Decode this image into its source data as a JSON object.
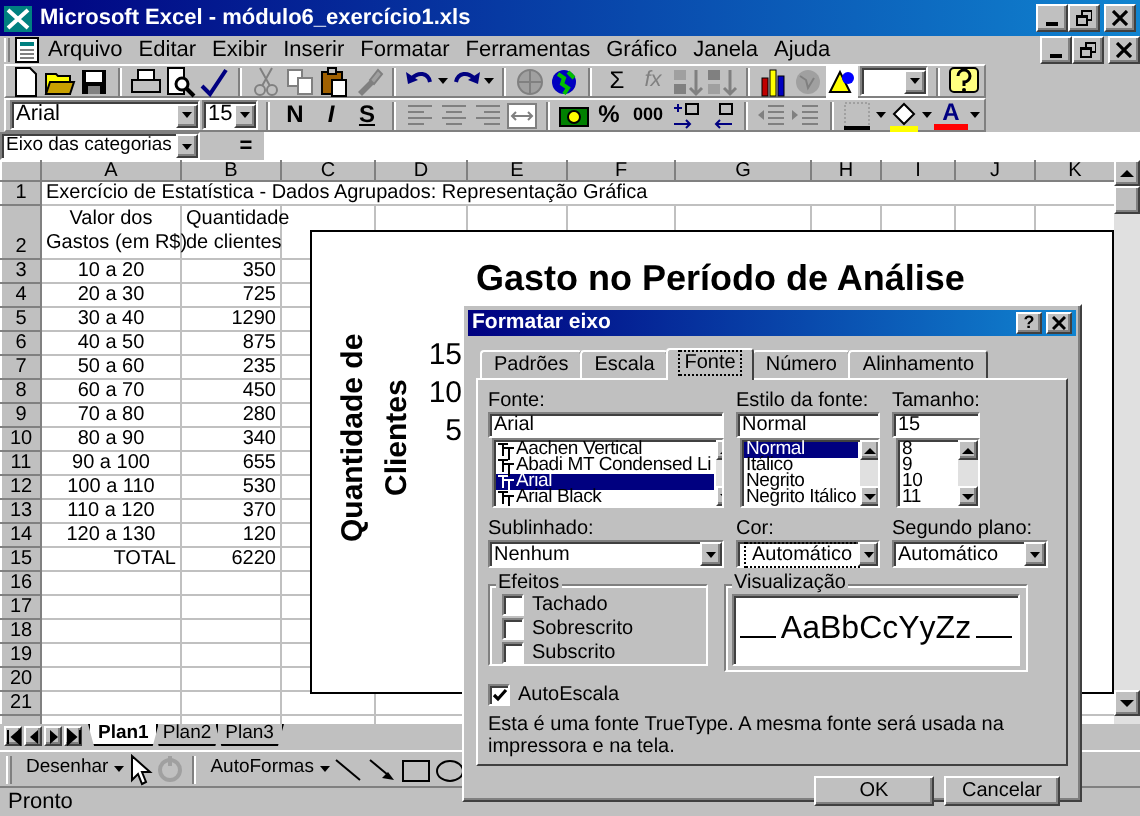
{
  "window": {
    "title": "Microsoft Excel - módulo6_exercício1.xls"
  },
  "menu": [
    "Arquivo",
    "Editar",
    "Exibir",
    "Inserir",
    "Formatar",
    "Ferramentas",
    "Gráfico",
    "Janela",
    "Ajuda"
  ],
  "standard_toolbar": {
    "autosum": "Σ",
    "function": "fx"
  },
  "formatting_toolbar": {
    "font": "Arial",
    "size": "15",
    "bold": "N",
    "italic": "I",
    "underline": "S",
    "percent": "%",
    "thousands": "000",
    "font_color": "A"
  },
  "formula_bar": {
    "name_box": "Eixo das categorias",
    "equals": "="
  },
  "sheet": {
    "columns": [
      "A",
      "B",
      "C",
      "D",
      "E",
      "F",
      "G",
      "H",
      "I",
      "J",
      "K"
    ],
    "rows": [
      {
        "number": "1",
        "kind": "title",
        "cells": [
          "Exercício de Estatística - Dados Agrupados: Representação Gráfica"
        ]
      },
      {
        "number": "2",
        "kind": "header",
        "cells": [
          [
            "Valor dos",
            "Gastos (em R$)"
          ],
          [
            "Quantidade",
            "de clientes"
          ]
        ]
      },
      {
        "number": "3",
        "kind": "data",
        "cells": [
          "10 a 20",
          "350"
        ]
      },
      {
        "number": "4",
        "kind": "data",
        "cells": [
          "20 a 30",
          "725"
        ]
      },
      {
        "number": "5",
        "kind": "data",
        "cells": [
          "30 a 40",
          "1290"
        ]
      },
      {
        "number": "6",
        "kind": "data",
        "cells": [
          "40 a 50",
          "875"
        ]
      },
      {
        "number": "7",
        "kind": "data",
        "cells": [
          "50 a 60",
          "235"
        ]
      },
      {
        "number": "8",
        "kind": "data",
        "cells": [
          "60 a 70",
          "450"
        ]
      },
      {
        "number": "9",
        "kind": "data",
        "cells": [
          "70 a 80",
          "280"
        ]
      },
      {
        "number": "10",
        "kind": "data",
        "cells": [
          "80 a 90",
          "340"
        ]
      },
      {
        "number": "11",
        "kind": "data",
        "cells": [
          "90 a 100",
          "655"
        ]
      },
      {
        "number": "12",
        "kind": "data",
        "cells": [
          "100 a 110",
          "530"
        ]
      },
      {
        "number": "13",
        "kind": "data",
        "cells": [
          "110 a 120",
          "370"
        ]
      },
      {
        "number": "14",
        "kind": "data",
        "cells": [
          "120 a 130",
          "120"
        ]
      },
      {
        "number": "15",
        "kind": "total",
        "cells": [
          "TOTAL",
          "6220"
        ]
      },
      {
        "number": "16",
        "kind": "empty"
      },
      {
        "number": "17",
        "kind": "empty"
      },
      {
        "number": "18",
        "kind": "empty"
      },
      {
        "number": "19",
        "kind": "empty"
      },
      {
        "number": "20",
        "kind": "empty"
      },
      {
        "number": "21",
        "kind": "empty"
      }
    ]
  },
  "chart": {
    "title": "Gasto no Período de Análise",
    "y_axis_title": "Quantidade de Clientes",
    "tick_labels": [
      "15",
      "10",
      "5"
    ]
  },
  "dialog": {
    "title": "Formatar eixo",
    "help": "?",
    "tabs": [
      {
        "label": "Padrões",
        "selected": false
      },
      {
        "label": "Escala",
        "selected": false
      },
      {
        "label": "Fonte",
        "selected": true
      },
      {
        "label": "Número",
        "selected": false
      },
      {
        "label": "Alinhamento",
        "selected": false
      }
    ],
    "font": {
      "label": "Fonte:",
      "value": "Arial",
      "options": [
        {
          "label": "Aachen Vertical",
          "selected": false
        },
        {
          "label": "Abadi MT Condensed Li",
          "selected": false
        },
        {
          "label": "Arial",
          "selected": true
        },
        {
          "label": "Arial Black",
          "selected": false
        }
      ]
    },
    "style": {
      "label": "Estilo da fonte:",
      "value": "Normal",
      "options": [
        {
          "label": "Normal",
          "selected": true
        },
        {
          "label": "Itálico",
          "selected": false
        },
        {
          "label": "Negrito",
          "selected": false
        },
        {
          "label": "Negrito Itálico",
          "selected": false
        }
      ]
    },
    "size": {
      "label": "Tamanho:",
      "value": "15",
      "options": [
        {
          "label": "8",
          "selected": false
        },
        {
          "label": "9",
          "selected": false
        },
        {
          "label": "10",
          "selected": false
        },
        {
          "label": "11",
          "selected": false
        }
      ]
    },
    "underline": {
      "label": "Sublinhado:",
      "value": "Nenhum",
      "focused": false
    },
    "color": {
      "label": "Cor:",
      "value": "Automático",
      "focused": true
    },
    "background": {
      "label": "Segundo plano:",
      "value": "Automático",
      "focused": false
    },
    "effects": {
      "label": "Efeitos",
      "options": [
        {
          "label": "Tachado",
          "checked": false
        },
        {
          "label": "Sobrescrito",
          "checked": false
        },
        {
          "label": "Subscrito",
          "checked": false
        }
      ]
    },
    "preview": {
      "label": "Visualização",
      "sample": "AaBbCcYyZz"
    },
    "auto_scale": {
      "label": "AutoEscala",
      "checked": true
    },
    "note": "Esta é uma fonte TrueType. A mesma fonte será usada na impressora e na tela.",
    "buttons": [
      "OK",
      "Cancelar"
    ]
  },
  "sheet_tabs": [
    {
      "label": "Plan1",
      "selected": true
    },
    {
      "label": "Plan2",
      "selected": false
    },
    {
      "label": "Plan3",
      "selected": false
    }
  ],
  "drawing_toolbar": {
    "draw": "Desenhar",
    "autoshapes": "AutoFormas"
  },
  "status_bar": "Pronto"
}
